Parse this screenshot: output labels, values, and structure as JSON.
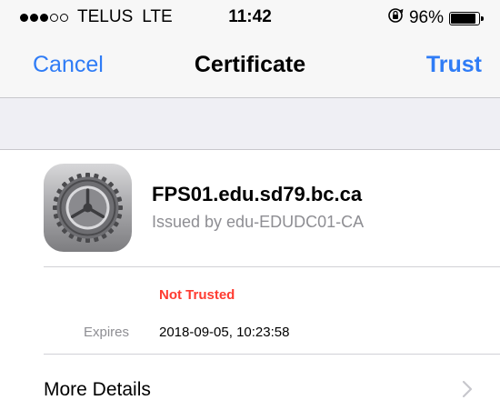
{
  "status_bar": {
    "carrier": "TELUS",
    "network": "LTE",
    "time": "11:42",
    "battery_percent": "96%",
    "battery_level": 0.96,
    "signal_bars": 3,
    "signal_max": 5,
    "icons": [
      "signal-dots-icon",
      "rotation-lock-icon",
      "battery-icon"
    ]
  },
  "nav": {
    "cancel_label": "Cancel",
    "title": "Certificate",
    "trust_label": "Trust"
  },
  "certificate": {
    "icon": "settings-gear-icon",
    "name": "FPS01.edu.sd79.bc.ca",
    "issuer": "Issued by edu-EDUDC01-CA",
    "trust_status": "Not Trusted",
    "expires_label": "Expires",
    "expires_value": "2018-09-05, 10:23:58"
  },
  "more_details": {
    "label": "More Details",
    "icon": "chevron-right-icon"
  },
  "colors": {
    "accent": "#2f7cf6",
    "danger": "#ff3b30",
    "secondary_text": "#8e8e93",
    "bar_background": "#f7f7f7",
    "group_background": "#efeff4"
  }
}
